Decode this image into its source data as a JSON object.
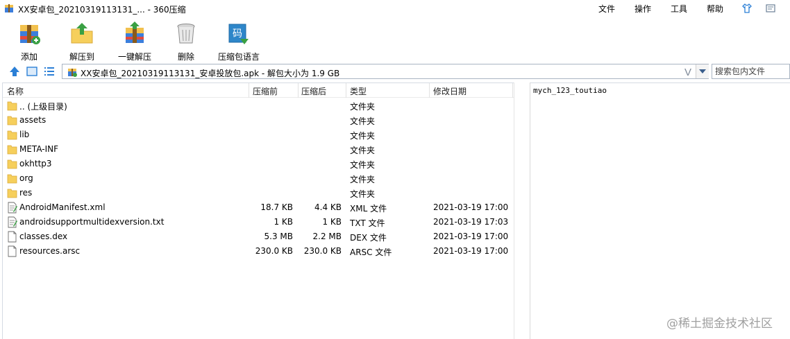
{
  "window": {
    "title": "XX安卓包_20210319113131_... - 360压缩"
  },
  "menu": {
    "items": [
      "文件",
      "操作",
      "工具",
      "帮助"
    ]
  },
  "toolbar": {
    "add_label": "添加",
    "extract_to_label": "解压到",
    "one_click_extract_label": "一键解压",
    "delete_label": "删除",
    "language_label": "压缩包语言",
    "language_icon_text": "码"
  },
  "address": {
    "path": "XX安卓包_20210319113131_安卓投放包.apk - 解包大小为 1.9 GB",
    "v_glyph": "V"
  },
  "search": {
    "placeholder": "搜索包内文件"
  },
  "columns": {
    "name": "名称",
    "original_size": "压缩前",
    "compressed_size": "压缩后",
    "type": "类型",
    "modified": "修改日期"
  },
  "files": [
    {
      "name": ".. (上级目录)",
      "original_size": "",
      "compressed_size": "",
      "type": "文件夹",
      "modified": "",
      "icon": "folder-icon"
    },
    {
      "name": "assets",
      "original_size": "",
      "compressed_size": "",
      "type": "文件夹",
      "modified": "",
      "icon": "folder-icon"
    },
    {
      "name": "lib",
      "original_size": "",
      "compressed_size": "",
      "type": "文件夹",
      "modified": "",
      "icon": "folder-icon"
    },
    {
      "name": "META-INF",
      "original_size": "",
      "compressed_size": "",
      "type": "文件夹",
      "modified": "",
      "icon": "folder-icon"
    },
    {
      "name": "okhttp3",
      "original_size": "",
      "compressed_size": "",
      "type": "文件夹",
      "modified": "",
      "icon": "folder-icon"
    },
    {
      "name": "org",
      "original_size": "",
      "compressed_size": "",
      "type": "文件夹",
      "modified": "",
      "icon": "folder-icon"
    },
    {
      "name": "res",
      "original_size": "",
      "compressed_size": "",
      "type": "文件夹",
      "modified": "",
      "icon": "folder-icon"
    },
    {
      "name": "AndroidManifest.xml",
      "original_size": "18.7 KB",
      "compressed_size": "4.4 KB",
      "type": "XML 文件",
      "modified": "2021-03-19 17:00",
      "icon": "text-file-icon"
    },
    {
      "name": "androidsupportmultidexversion.txt",
      "original_size": "1 KB",
      "compressed_size": "1 KB",
      "type": "TXT 文件",
      "modified": "2021-03-19 17:03",
      "icon": "text-file-icon"
    },
    {
      "name": "classes.dex",
      "original_size": "5.3 MB",
      "compressed_size": "2.2 MB",
      "type": "DEX 文件",
      "modified": "2021-03-19 17:00",
      "icon": "blank-file-icon"
    },
    {
      "name": "resources.arsc",
      "original_size": "230.0 KB",
      "compressed_size": "230.0 KB",
      "type": "ARSC 文件",
      "modified": "2021-03-19 17:00",
      "icon": "blank-file-icon"
    }
  ],
  "comment": {
    "text": "mych_123_toutiao"
  },
  "watermark": {
    "text": "@稀土掘金技术社区"
  },
  "colors": {
    "folder": "#f6cf5c",
    "accent_blue": "#2b7fd6",
    "green": "#3aa043"
  }
}
